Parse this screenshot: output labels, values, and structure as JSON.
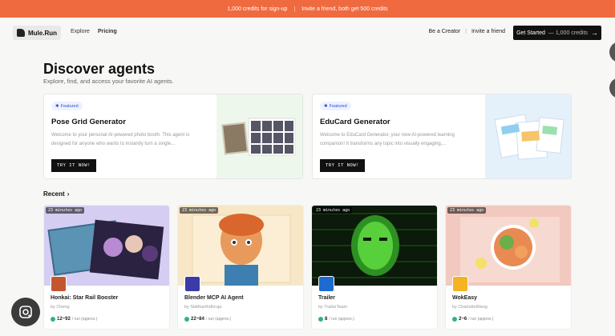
{
  "promo": {
    "left_text": "1,000 credits for sign-up",
    "separator": "|",
    "right_text": "Invite a friend, both get 500 credits"
  },
  "nav": {
    "brand": "Mule.Run",
    "links": [
      "Explore",
      "Pricing"
    ],
    "creator": "Be a Creator",
    "divider": "|",
    "invite": "Invite a friend",
    "cta": "Get Started",
    "cta_note": "— 1,000 credits",
    "cta_arrow": "→"
  },
  "hero": {
    "title": "Discover agents",
    "subtitle": "Explore, find, and access your favorite AI agents."
  },
  "featured": [
    {
      "badge": "Featured",
      "title": "Pose Grid Generator",
      "description": "Welcome to your personal AI-powered photo booth. This agent is designed for anyone who wants to instantly turn a single...",
      "button": "TRY IT NOW!"
    },
    {
      "badge": "Featured",
      "title": "EduCard Generator",
      "description": "Welcome to EduCard Generator, your new AI-powered learning companion! It transforms any topic into visually engaging,...",
      "button": "TRY IT NOW!"
    }
  ],
  "recent": {
    "label": "Recent",
    "chevron": "›"
  },
  "cards": [
    {
      "time": "23 minutes ago",
      "title": "Honkai: Star Rail Booster",
      "by": "by Cheng",
      "price": "12~92",
      "unit": "/ run (approx.)"
    },
    {
      "time": "23 minutes ago",
      "title": "Blender MCP AI Agent",
      "by": "by Siddharthdhruja",
      "price": "22~84",
      "unit": "/ run (approx.)"
    },
    {
      "time": "23 minutes ago",
      "title": "Trailer",
      "by": "by TrailerTeam",
      "price": "8",
      "unit": "/ run (approx.)"
    },
    {
      "time": "23 minutes ago",
      "title": "WokEasy",
      "by": "by CharlotteWang",
      "price": "2~6",
      "unit": "/ run (approx.)"
    }
  ],
  "icons": {
    "brand": "mule-logo-icon",
    "badge": "star-icon",
    "credit": "credit-dot-icon",
    "lens": "google-lens-icon"
  },
  "colors": {
    "promo": "#ef6a3f",
    "accent": "#111111",
    "badge": "#2b4fd1",
    "credit": "#2fb57d"
  }
}
